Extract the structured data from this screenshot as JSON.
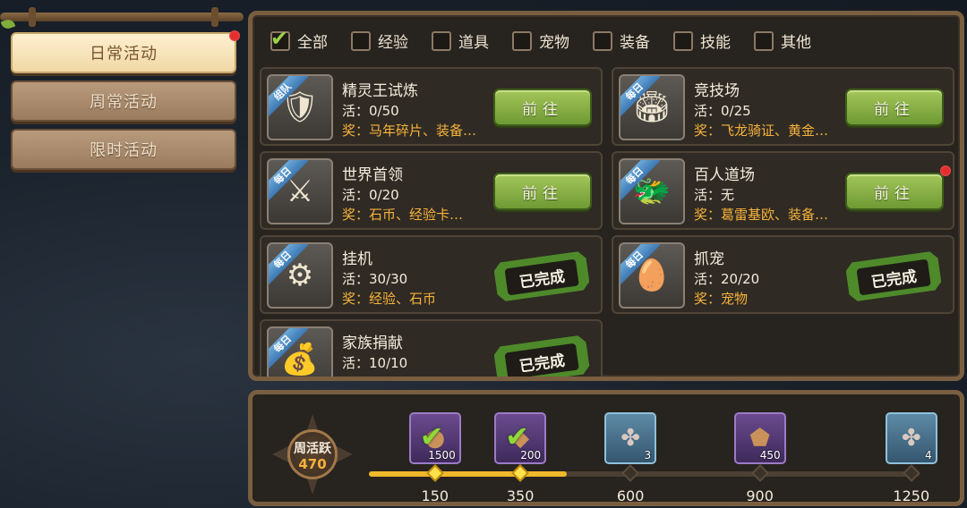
{
  "nav": {
    "items": [
      {
        "label": "日常活动",
        "active": true,
        "badge": true
      },
      {
        "label": "周常活动",
        "active": false,
        "badge": false
      },
      {
        "label": "限时活动",
        "active": false,
        "badge": false
      }
    ]
  },
  "filters": [
    {
      "label": "全部",
      "checked": true
    },
    {
      "label": "经验",
      "checked": false
    },
    {
      "label": "道具",
      "checked": false
    },
    {
      "label": "宠物",
      "checked": false
    },
    {
      "label": "装备",
      "checked": false
    },
    {
      "label": "技能",
      "checked": false
    },
    {
      "label": "其他",
      "checked": false
    }
  ],
  "tasks": [
    {
      "tag": "组队",
      "title": "精灵王试炼",
      "progress": "活：0/50",
      "reward": "奖：马年碎片、装备…",
      "action": "前往",
      "icon": "warrior-icon"
    },
    {
      "tag": "每日",
      "title": "竞技场",
      "progress": "活：0/25",
      "reward": "奖：飞龙骑证、黄金…",
      "action": "前往",
      "icon": "arena-icon"
    },
    {
      "tag": "每日",
      "title": "世界首领",
      "progress": "活：0/20",
      "reward": "奖：石币、经验卡…",
      "action": "前往",
      "icon": "boss-icon"
    },
    {
      "tag": "每日",
      "title": "百人道场",
      "progress": "活：无",
      "reward": "奖：葛雷基欧、装备…",
      "action": "前往",
      "icon": "dojo-icon",
      "badge": true
    },
    {
      "tag": "每日",
      "title": "挂机",
      "progress": "活：30/30",
      "reward": "奖：经验、石币",
      "action": "已完成",
      "icon": "idle-machine-icon"
    },
    {
      "tag": "每日",
      "title": "抓宠",
      "progress": "活：20/20",
      "reward": "奖：宠物",
      "action": "已完成",
      "icon": "pet-egg-icon"
    },
    {
      "tag": "每日",
      "title": "家族捐献",
      "progress": "活：10/10",
      "reward": "",
      "action": "已完成",
      "icon": "donation-icon"
    }
  ],
  "weekly": {
    "label": "周活跃",
    "value": "470",
    "progress_fraction": 0.36,
    "milestones": [
      {
        "threshold": "150",
        "reward_count": "1500",
        "claimed": true,
        "style": "purple",
        "icon": "stone-coin-icon",
        "fraction": 0.12
      },
      {
        "threshold": "350",
        "reward_count": "200",
        "claimed": true,
        "style": "purple",
        "icon": "gem-icon",
        "fraction": 0.275
      },
      {
        "threshold": "600",
        "reward_count": "3",
        "claimed": false,
        "style": "blue",
        "icon": "clover-coin-icon",
        "fraction": 0.475
      },
      {
        "threshold": "900",
        "reward_count": "450",
        "claimed": false,
        "style": "purple",
        "icon": "orange-gem-icon",
        "fraction": 0.71
      },
      {
        "threshold": "1250",
        "reward_count": "4",
        "claimed": false,
        "style": "blue",
        "icon": "clover-coin-icon",
        "fraction": 0.985
      }
    ]
  }
}
